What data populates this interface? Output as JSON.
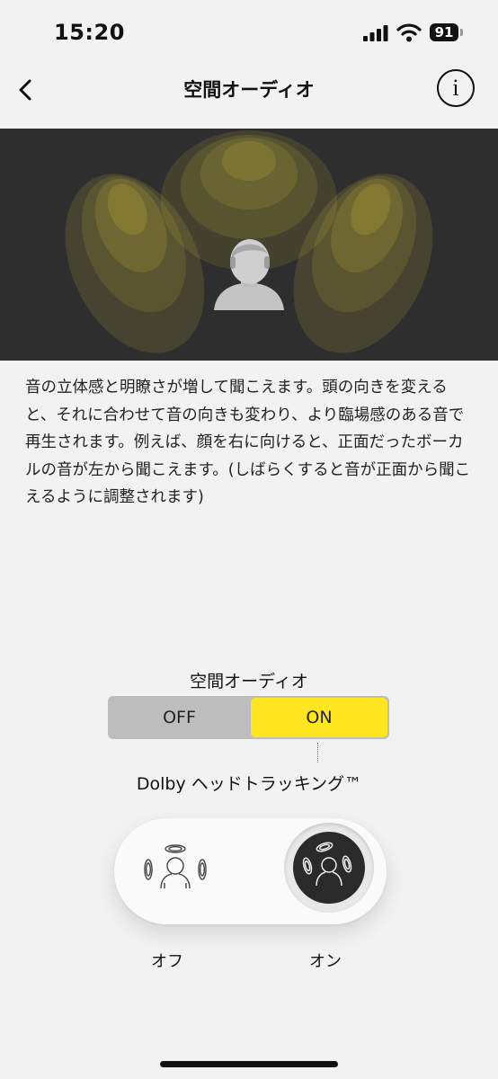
{
  "status_bar": {
    "time": "15:20",
    "battery": "91"
  },
  "nav": {
    "title": "空間オーディオ",
    "info_glyph": "i"
  },
  "description": "音の立体感と明瞭さが増して聞こえます。頭の向きを変えると、それに合わせて音の向きも変わり、より臨場感のある音で再生されます。例えば、顔を右に向けると、正面だったボーカルの音が左から聞こえます。(しばらくすると音が正面から聞こえるように調整されます)",
  "spatial_toggle": {
    "label": "空間オーディオ",
    "off": "OFF",
    "on": "ON",
    "selected": "ON"
  },
  "head_tracking": {
    "label": "Dolby ヘッドトラッキング™",
    "off_label": "オフ",
    "on_label": "オン",
    "selected": "on"
  },
  "colors": {
    "accent": "#ffe620",
    "hero_bg": "#2e2e2e"
  },
  "icons": [
    "back-chevron-icon",
    "info-icon",
    "signal-icon",
    "wifi-icon",
    "battery-icon",
    "head-tracking-off-icon",
    "head-tracking-on-icon"
  ]
}
